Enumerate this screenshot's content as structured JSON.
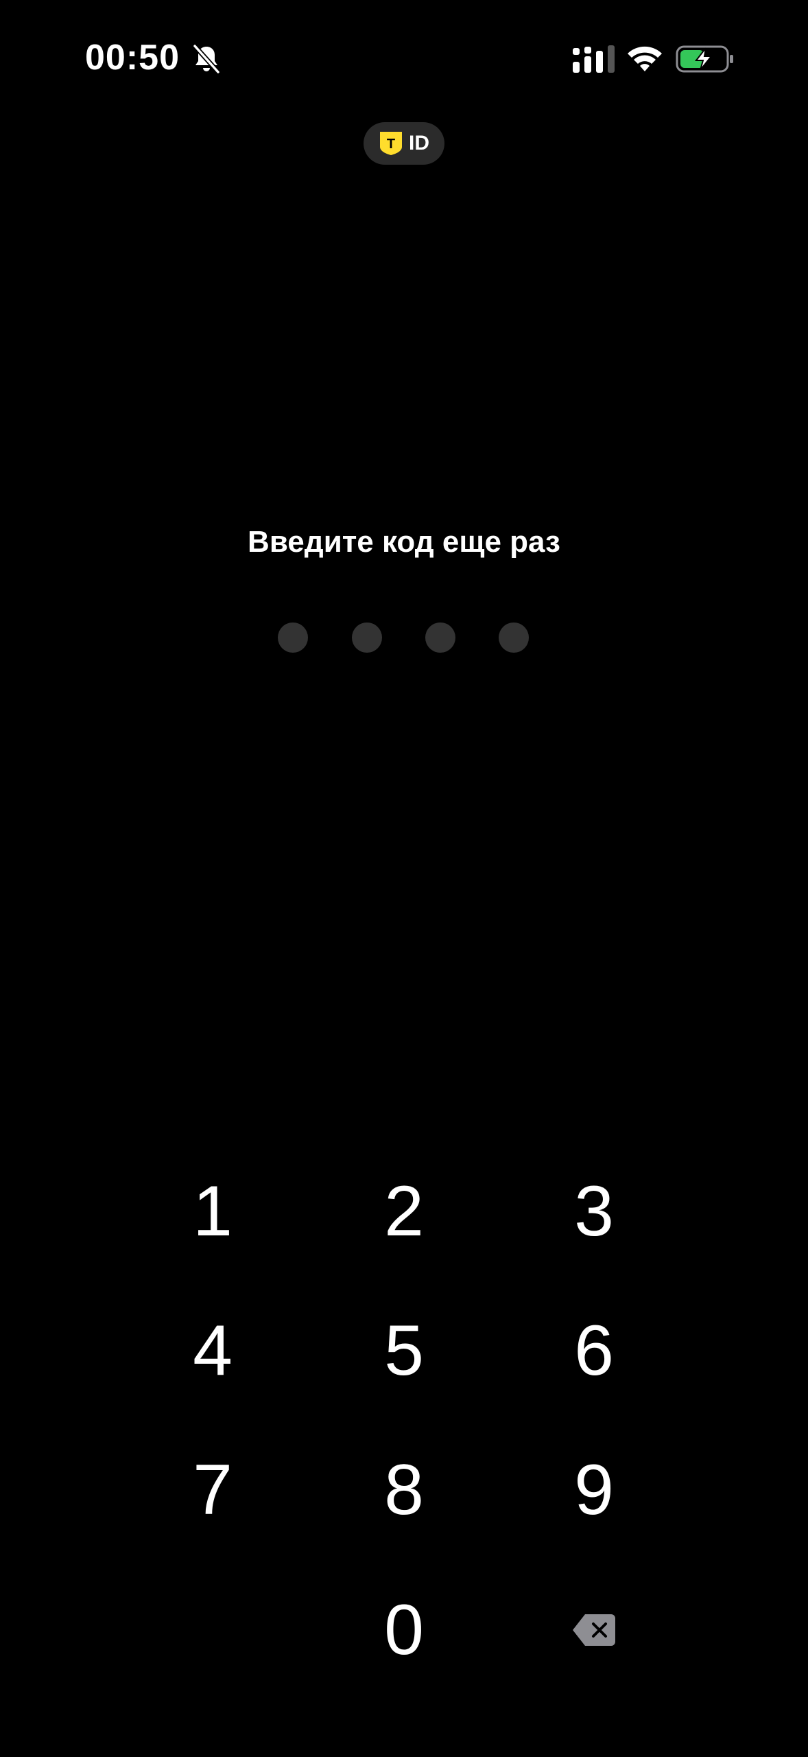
{
  "status_bar": {
    "time": "00:50",
    "icons": [
      "bell-off-icon",
      "cellular-signal-icon",
      "wifi-icon",
      "battery-charging-icon"
    ],
    "battery_color": "#34c759"
  },
  "badge": {
    "logo_letter": "T",
    "label": "ID",
    "logo_color": "#ffdd2d"
  },
  "prompt": "Введите код еще раз",
  "pin": {
    "length": 4,
    "filled": 0
  },
  "keypad": {
    "keys": [
      "1",
      "2",
      "3",
      "4",
      "5",
      "6",
      "7",
      "8",
      "9",
      "0"
    ],
    "backspace_icon": "backspace-icon"
  },
  "colors": {
    "background": "#000000",
    "text": "#ffffff",
    "dot_empty": "#333333",
    "badge_bg": "#2b2b2b"
  }
}
